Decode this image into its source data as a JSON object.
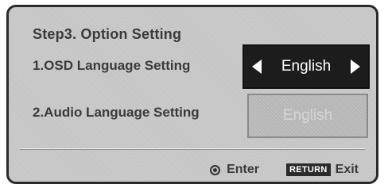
{
  "header": {
    "title": "Step3.  Option Setting"
  },
  "settings": [
    {
      "label": "1.OSD Language Setting",
      "value": "English",
      "state": "selected"
    },
    {
      "label": "2.Audio Language Setting",
      "value": "English",
      "state": "disabled"
    }
  ],
  "footer": {
    "enter_label": "Enter",
    "return_key": "RETURN",
    "exit_label": "Exit"
  },
  "icons": {
    "enter": "enter-icon",
    "left": "arrow-left-icon",
    "right": "arrow-right-icon"
  },
  "colors": {
    "panel_bg": "#c4c4c4",
    "selected_bg": "#1c1c1c",
    "selected_text": "#ffffff",
    "disabled_text": "#d6d6d6"
  }
}
